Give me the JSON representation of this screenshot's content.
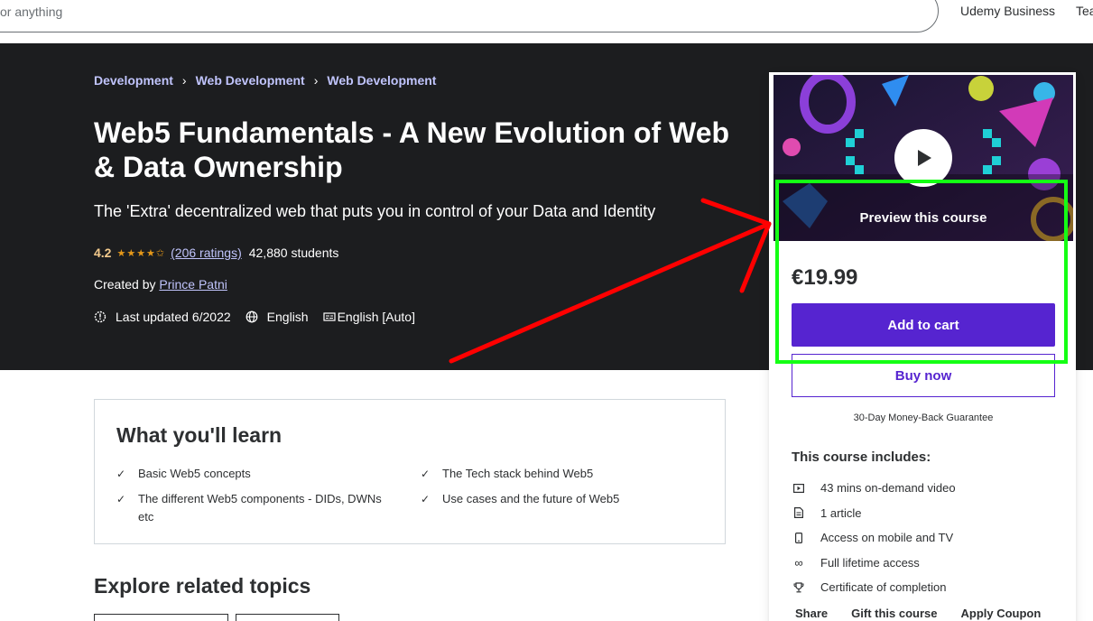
{
  "header": {
    "search_placeholder": "or anything",
    "udemy_business": "Udemy Business",
    "teach": "Tea"
  },
  "breadcrumb": [
    "Development",
    "Web Development",
    "Web Development"
  ],
  "course": {
    "title": "Web5 Fundamentals - A New Evolution of Web & Data Ownership",
    "subtitle": "The 'Extra' decentralized web that puts you in control of your Data and Identity",
    "rating": "4.2",
    "stars": "★★★★✩",
    "ratings_count": "(206 ratings)",
    "students": "42,880 students",
    "created_by_label": "Created by",
    "instructor": "Prince Patni",
    "last_updated": "Last updated 6/2022",
    "language": "English",
    "captions": "English [Auto]"
  },
  "card": {
    "preview_label": "Preview this course",
    "price": "€19.99",
    "add_to_cart": "Add to cart",
    "buy_now": "Buy now",
    "guarantee": "30-Day Money-Back Guarantee",
    "includes_title": "This course includes:",
    "includes": [
      {
        "icon": "video-icon",
        "label": "43 mins on-demand video"
      },
      {
        "icon": "article-icon",
        "label": "1 article"
      },
      {
        "icon": "mobile-icon",
        "label": "Access on mobile and TV"
      },
      {
        "icon": "infinity-icon",
        "label": "Full lifetime access"
      },
      {
        "icon": "trophy-icon",
        "label": "Certificate of completion"
      }
    ],
    "share": "Share",
    "gift": "Gift this course",
    "coupon": "Apply Coupon"
  },
  "learn": {
    "title": "What you'll learn",
    "items": [
      "Basic Web5 concepts",
      "The Tech stack behind Web5",
      "The different Web5 components - DIDs, DWNs etc",
      "Use cases and the future of Web5"
    ]
  },
  "explore": {
    "title": "Explore related topics"
  },
  "colors": {
    "hero_bg": "#1c1d1f",
    "accent_purple": "#5624d0",
    "link_lavender": "#c0c4fc",
    "rating_gold": "#f3ca8c",
    "highlight_green": "#14ff14",
    "annotation_red": "#ff0000"
  }
}
